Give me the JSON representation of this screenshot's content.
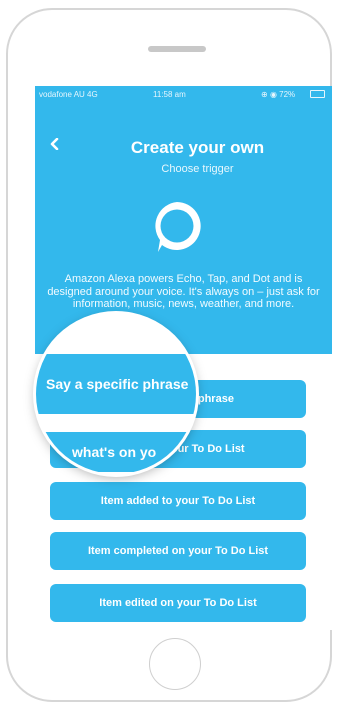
{
  "status_bar": {
    "carrier": "vodafone AU  4G",
    "time": "11:58 am",
    "battery": "72%",
    "battery_level": 0.72
  },
  "header": {
    "title": "Create your own",
    "subtitle": "Choose trigger",
    "service_icon": "alexa-icon"
  },
  "description": "Amazon Alexa powers Echo, Tap, and Dot and is designed around your voice. It's always on – just ask for information, music, news, weather, and more.",
  "triggers": [
    {
      "label": "Say a specific phrase"
    },
    {
      "label": "what's on your To Do List"
    },
    {
      "label": "Item added to your To Do List"
    },
    {
      "label": "Item completed on your To Do List"
    },
    {
      "label": "Item edited on your To Do List"
    }
  ],
  "magnifier": {
    "primary_text": "Say a specific phrase",
    "secondary_text": "what's on yo"
  },
  "colors": {
    "accent": "#33b8ec",
    "text_on_accent": "#ffffff"
  }
}
